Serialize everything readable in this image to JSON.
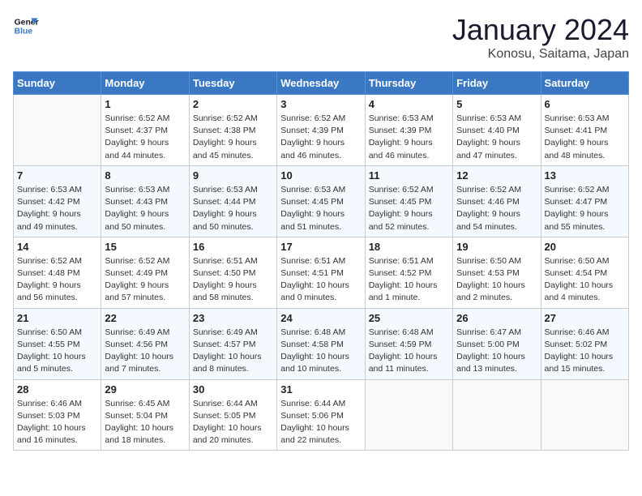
{
  "header": {
    "logo_line1": "General",
    "logo_line2": "Blue",
    "title": "January 2024",
    "subtitle": "Konosu, Saitama, Japan"
  },
  "days_of_week": [
    "Sunday",
    "Monday",
    "Tuesday",
    "Wednesday",
    "Thursday",
    "Friday",
    "Saturday"
  ],
  "weeks": [
    [
      {
        "day": "",
        "info": ""
      },
      {
        "day": "1",
        "info": "Sunrise: 6:52 AM\nSunset: 4:37 PM\nDaylight: 9 hours\nand 44 minutes."
      },
      {
        "day": "2",
        "info": "Sunrise: 6:52 AM\nSunset: 4:38 PM\nDaylight: 9 hours\nand 45 minutes."
      },
      {
        "day": "3",
        "info": "Sunrise: 6:52 AM\nSunset: 4:39 PM\nDaylight: 9 hours\nand 46 minutes."
      },
      {
        "day": "4",
        "info": "Sunrise: 6:53 AM\nSunset: 4:39 PM\nDaylight: 9 hours\nand 46 minutes."
      },
      {
        "day": "5",
        "info": "Sunrise: 6:53 AM\nSunset: 4:40 PM\nDaylight: 9 hours\nand 47 minutes."
      },
      {
        "day": "6",
        "info": "Sunrise: 6:53 AM\nSunset: 4:41 PM\nDaylight: 9 hours\nand 48 minutes."
      }
    ],
    [
      {
        "day": "7",
        "info": "Sunrise: 6:53 AM\nSunset: 4:42 PM\nDaylight: 9 hours\nand 49 minutes."
      },
      {
        "day": "8",
        "info": "Sunrise: 6:53 AM\nSunset: 4:43 PM\nDaylight: 9 hours\nand 50 minutes."
      },
      {
        "day": "9",
        "info": "Sunrise: 6:53 AM\nSunset: 4:44 PM\nDaylight: 9 hours\nand 50 minutes."
      },
      {
        "day": "10",
        "info": "Sunrise: 6:53 AM\nSunset: 4:45 PM\nDaylight: 9 hours\nand 51 minutes."
      },
      {
        "day": "11",
        "info": "Sunrise: 6:52 AM\nSunset: 4:45 PM\nDaylight: 9 hours\nand 52 minutes."
      },
      {
        "day": "12",
        "info": "Sunrise: 6:52 AM\nSunset: 4:46 PM\nDaylight: 9 hours\nand 54 minutes."
      },
      {
        "day": "13",
        "info": "Sunrise: 6:52 AM\nSunset: 4:47 PM\nDaylight: 9 hours\nand 55 minutes."
      }
    ],
    [
      {
        "day": "14",
        "info": "Sunrise: 6:52 AM\nSunset: 4:48 PM\nDaylight: 9 hours\nand 56 minutes."
      },
      {
        "day": "15",
        "info": "Sunrise: 6:52 AM\nSunset: 4:49 PM\nDaylight: 9 hours\nand 57 minutes."
      },
      {
        "day": "16",
        "info": "Sunrise: 6:51 AM\nSunset: 4:50 PM\nDaylight: 9 hours\nand 58 minutes."
      },
      {
        "day": "17",
        "info": "Sunrise: 6:51 AM\nSunset: 4:51 PM\nDaylight: 10 hours\nand 0 minutes."
      },
      {
        "day": "18",
        "info": "Sunrise: 6:51 AM\nSunset: 4:52 PM\nDaylight: 10 hours\nand 1 minute."
      },
      {
        "day": "19",
        "info": "Sunrise: 6:50 AM\nSunset: 4:53 PM\nDaylight: 10 hours\nand 2 minutes."
      },
      {
        "day": "20",
        "info": "Sunrise: 6:50 AM\nSunset: 4:54 PM\nDaylight: 10 hours\nand 4 minutes."
      }
    ],
    [
      {
        "day": "21",
        "info": "Sunrise: 6:50 AM\nSunset: 4:55 PM\nDaylight: 10 hours\nand 5 minutes."
      },
      {
        "day": "22",
        "info": "Sunrise: 6:49 AM\nSunset: 4:56 PM\nDaylight: 10 hours\nand 7 minutes."
      },
      {
        "day": "23",
        "info": "Sunrise: 6:49 AM\nSunset: 4:57 PM\nDaylight: 10 hours\nand 8 minutes."
      },
      {
        "day": "24",
        "info": "Sunrise: 6:48 AM\nSunset: 4:58 PM\nDaylight: 10 hours\nand 10 minutes."
      },
      {
        "day": "25",
        "info": "Sunrise: 6:48 AM\nSunset: 4:59 PM\nDaylight: 10 hours\nand 11 minutes."
      },
      {
        "day": "26",
        "info": "Sunrise: 6:47 AM\nSunset: 5:00 PM\nDaylight: 10 hours\nand 13 minutes."
      },
      {
        "day": "27",
        "info": "Sunrise: 6:46 AM\nSunset: 5:02 PM\nDaylight: 10 hours\nand 15 minutes."
      }
    ],
    [
      {
        "day": "28",
        "info": "Sunrise: 6:46 AM\nSunset: 5:03 PM\nDaylight: 10 hours\nand 16 minutes."
      },
      {
        "day": "29",
        "info": "Sunrise: 6:45 AM\nSunset: 5:04 PM\nDaylight: 10 hours\nand 18 minutes."
      },
      {
        "day": "30",
        "info": "Sunrise: 6:44 AM\nSunset: 5:05 PM\nDaylight: 10 hours\nand 20 minutes."
      },
      {
        "day": "31",
        "info": "Sunrise: 6:44 AM\nSunset: 5:06 PM\nDaylight: 10 hours\nand 22 minutes."
      },
      {
        "day": "",
        "info": ""
      },
      {
        "day": "",
        "info": ""
      },
      {
        "day": "",
        "info": ""
      }
    ]
  ]
}
